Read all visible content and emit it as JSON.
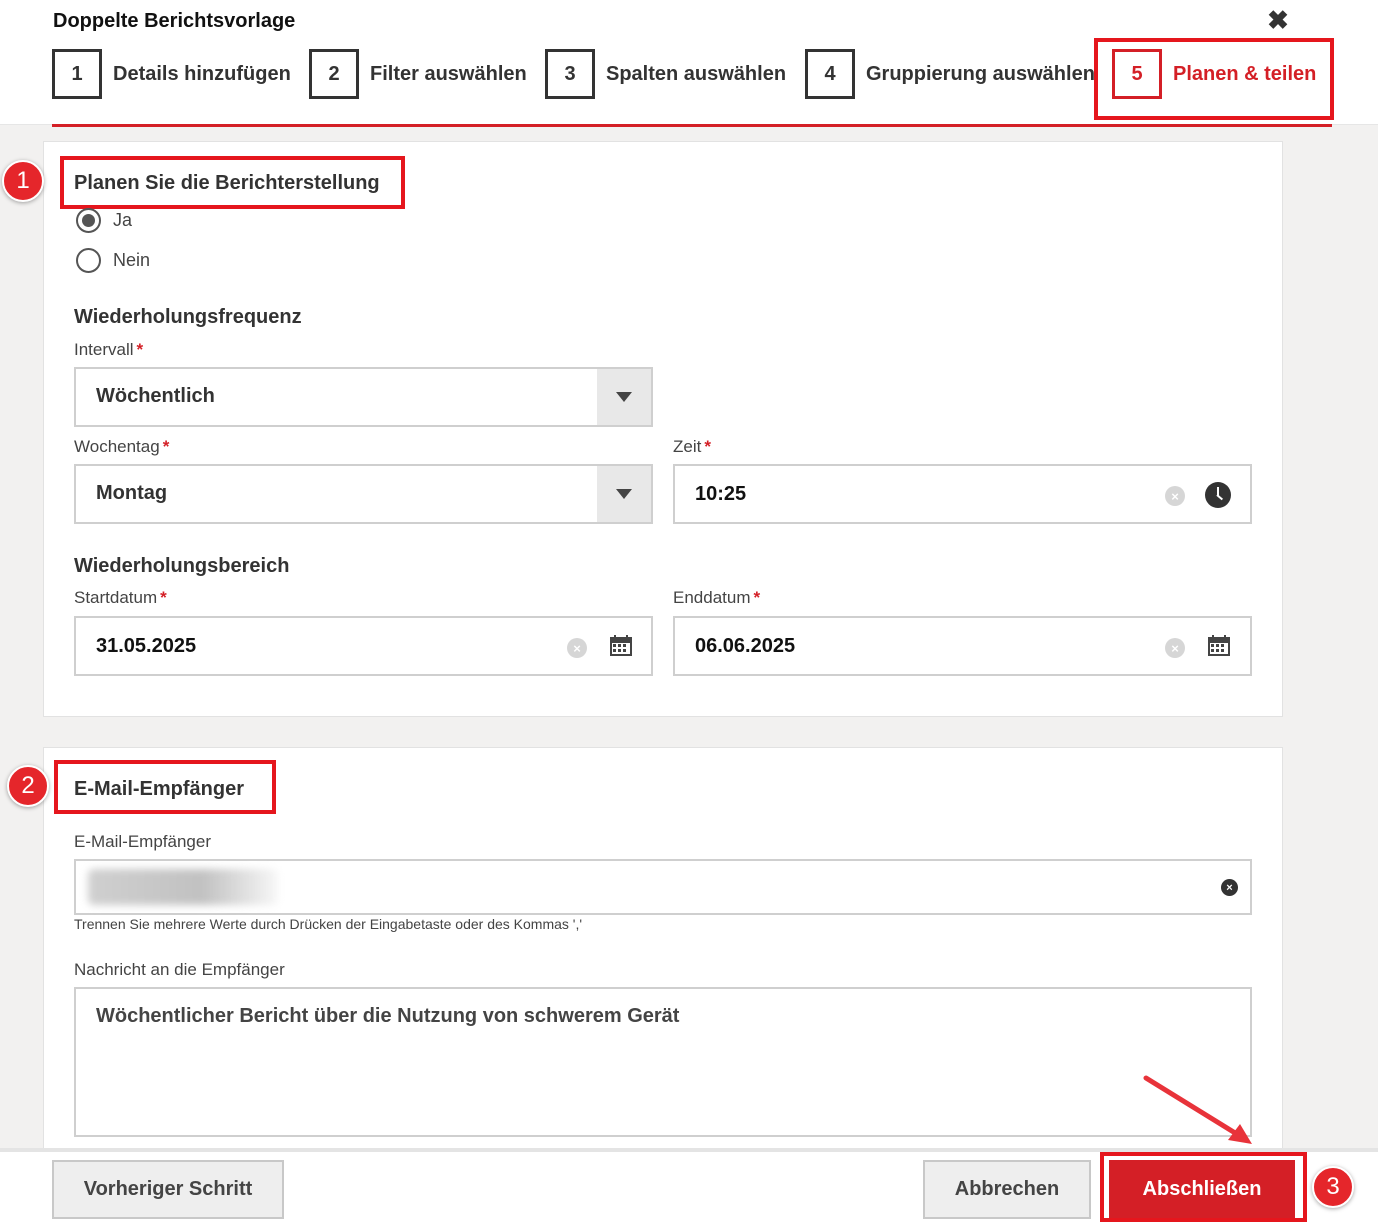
{
  "dialog": {
    "title": "Doppelte Berichtsvorlage",
    "close_label": "✖"
  },
  "steps": [
    {
      "number": "1",
      "label": "Details hinzufügen",
      "active": false
    },
    {
      "number": "2",
      "label": "Filter auswählen",
      "active": false
    },
    {
      "number": "3",
      "label": "Spalten auswählen",
      "active": false
    },
    {
      "number": "4",
      "label": "Gruppierung auswählen",
      "active": false
    },
    {
      "number": "5",
      "label": "Planen & teilen",
      "active": true
    }
  ],
  "schedule": {
    "title": "Planen Sie die Berichterstellung",
    "options": [
      {
        "label": "Ja",
        "checked": true
      },
      {
        "label": "Nein",
        "checked": false
      }
    ],
    "frequency_title": "Wiederholungsfrequenz",
    "interval_label": "Intervall",
    "interval_value": "Wöchentlich",
    "weekday_label": "Wochentag",
    "weekday_value": "Montag",
    "time_label": "Zeit",
    "time_value": "10:25",
    "range_title": "Wiederholungsbereich",
    "start_label": "Startdatum",
    "start_value": "31.05.2025",
    "end_label": "Enddatum",
    "end_value": "06.06.2025",
    "required_mark": "*"
  },
  "email": {
    "title": "E-Mail-Empfänger",
    "recipients_label": "E-Mail-Empfänger",
    "hint": "Trennen Sie mehrere Werte durch Drücken der Eingabetaste oder des Kommas ','",
    "message_label": "Nachricht an die Empfänger",
    "message_value": "Wöchentlicher Bericht über die Nutzung von schwerem Gerät"
  },
  "footer": {
    "previous_label": "Vorheriger Schritt",
    "cancel_label": "Abbrechen",
    "finish_label": "Abschließen"
  },
  "annotations": {
    "badge_1": "1",
    "badge_2": "2",
    "badge_3": "3",
    "highlight_color": "#e5161d"
  },
  "icons": {
    "close": "close-icon",
    "dropdown": "chevron-down-icon",
    "clear": "clear-icon",
    "clock": "clock-icon",
    "calendar": "calendar-icon"
  },
  "colors": {
    "accent": "#d41f26",
    "text": "#333333",
    "border": "#cfcfcf"
  }
}
